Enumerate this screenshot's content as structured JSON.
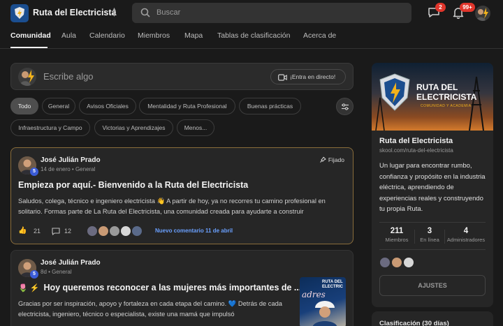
{
  "header": {
    "community_name": "Ruta del Electricista",
    "search_placeholder": "Buscar",
    "chat_badge": "2",
    "notifications_badge": "99+"
  },
  "nav": {
    "tabs": [
      "Comunidad",
      "Aula",
      "Calendario",
      "Miembros",
      "Mapa",
      "Tablas de clasificación",
      "Acerca de"
    ],
    "active": "Comunidad"
  },
  "composer": {
    "placeholder": "Escribe algo",
    "live_button": "¡Entra en directo!"
  },
  "filters": {
    "chips": [
      "Todo",
      "General",
      "Avisos Oficiales",
      "Mentalidad y Ruta Profesional",
      "Buenas prácticas",
      "Infraestructura y Campo",
      "Victorias y Aprendizajes",
      "Menos..."
    ],
    "active": "Todo"
  },
  "posts": [
    {
      "author": "José Julián  Prado",
      "level": "5",
      "meta": "14 de enero • General",
      "pinned_label": "Fijado",
      "title": "Empieza por aquí.- Bienvenido a la Ruta del Electricista",
      "body": "Saludos, colega, técnico e ingeniero electricista 👋 A partir de hoy, ya no recorres tu camino profesional en solitario. Formas parte de La Ruta del Electricista, una comunidad creada para ayudarte a construir",
      "likes": "21",
      "comments": "12",
      "new_comment": "Nuevo comentario 11 de abril"
    },
    {
      "author": "José Julián  Prado",
      "level": "5",
      "meta": "8d • General",
      "title_emoji": "🌷 ⚡",
      "title": "Hoy queremos reconocer a las mujeres más importantes de ...",
      "body": "Gracias por ser inspiración, apoyo y fortaleza en cada etapa del camino. 💙 Detrás de cada electricista, ingeniero, técnico o especialista, existe una mamá que impulsó"
    }
  ],
  "sidebar": {
    "cover_title_line1": "RUTA DEL",
    "cover_title_line2": "ELECTRICISTA",
    "cover_subtitle": "COMUNIDAD Y ACADEMIA",
    "name": "Ruta del Electricista",
    "url": "skool.com/ruta-del-electricista",
    "description": "Un lugar para encontrar rumbo, confianza y propósito en la industria eléctrica, aprendiendo de experiencias reales y construyendo tu propia Ruta.",
    "stats": [
      {
        "value": "211",
        "label": "Miembros"
      },
      {
        "value": "3",
        "label": "En línea"
      },
      {
        "value": "4",
        "label": "Administradores"
      }
    ],
    "settings_button": "AJUSTES",
    "leaderboard_title": "Clasificación (30 días)"
  },
  "thumbnail": {
    "line1": "RUTA DEL",
    "line2": "ELECTRIC",
    "script": "adres"
  },
  "colors": {
    "accent_blue": "#6aa0ff",
    "badge_red": "#e0352b",
    "pinned_border": "#8a6d3b"
  }
}
